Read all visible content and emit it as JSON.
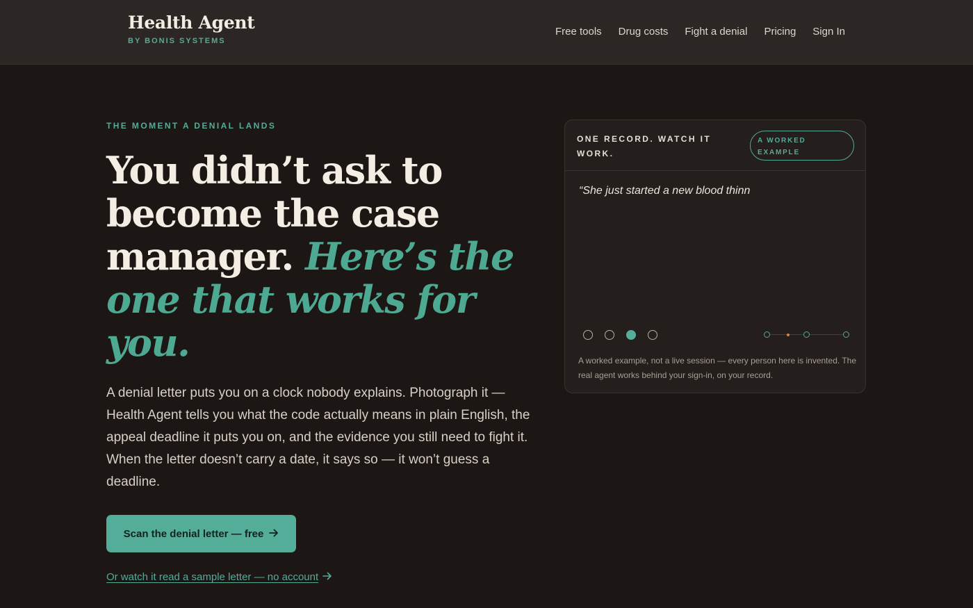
{
  "brand": {
    "name": "Health Agent",
    "sub": "BY BONIS SYSTEMS"
  },
  "nav": {
    "items": [
      "Free tools",
      "Drug costs",
      "Fight a denial",
      "Pricing",
      "Sign In"
    ]
  },
  "hero": {
    "eyebrow": "THE MOMENT A DENIAL LANDS",
    "headline_plain": "You didn’t ask to become the case manager.",
    "headline_accent": "Here’s the one that works for you.",
    "lede": "A denial letter puts you on a clock nobody explains. Photograph it — Health Agent tells you what the code actually means in plain English, the appeal deadline it puts you on, and the evidence you still need to fight it. When the letter doesn’t carry a date, it says so — it won’t guess a deadline.",
    "cta_label": "Scan the denial letter — free",
    "secondary_label": "Or watch it read a sample letter — no account"
  },
  "card": {
    "title": "ONE RECORD. WATCH IT WORK.",
    "pill": "A WORKED EXAMPLE",
    "quote": "“She just started a new blood thinn",
    "slides_active": 3,
    "slides_total": 4,
    "note": "A worked example, not a live session — every person here is invented. The real agent works behind your sign-in, on your record."
  },
  "colors": {
    "accent": "#54ad99",
    "background": "#1c1715",
    "topbar": "#2c2724",
    "timeline_marker": "#d9844c"
  },
  "icons": {
    "cta_arrow": "arrow-right-icon",
    "link_arrow": "arrow-right-icon"
  }
}
